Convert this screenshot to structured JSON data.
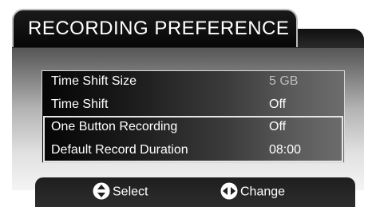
{
  "header": {
    "title": "RECORDING PREFERENCE"
  },
  "menu": {
    "items": [
      {
        "label": "Time  Shift Size",
        "value": "5 GB",
        "enabled": false
      },
      {
        "label": "Time  Shift",
        "value": "Off",
        "enabled": true
      },
      {
        "label": "One Button Recording",
        "value": "Off",
        "enabled": true
      },
      {
        "label": "Default Record Duration",
        "value": "08:00",
        "enabled": true
      }
    ]
  },
  "footer": {
    "select_label": "Select",
    "select_icon": "up-down-arrows-icon",
    "change_label": "Change",
    "change_icon": "left-right-arrows-icon"
  },
  "colors": {
    "text": "#ffffff",
    "disabled_value": "#bdbdbd",
    "focus_border": "#e6e6e6"
  }
}
